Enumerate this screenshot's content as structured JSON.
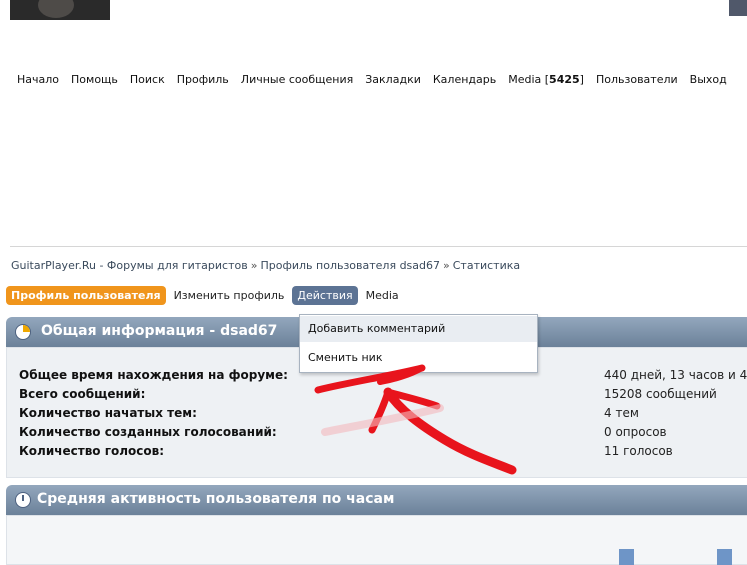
{
  "nav": {
    "items": [
      {
        "label": "Начало"
      },
      {
        "label": "Помощь"
      },
      {
        "label": "Поиск"
      },
      {
        "label": "Профиль"
      },
      {
        "label": "Личные сообщения"
      },
      {
        "label": "Закладки"
      },
      {
        "label": "Календарь"
      },
      {
        "label": "Media [",
        "count": "5425",
        "suffix": "]"
      },
      {
        "label": "Пользователи"
      },
      {
        "label": "Выход"
      }
    ]
  },
  "breadcrumb": {
    "items": [
      "GuitarPlayer.Ru - Форумы для гитаристов",
      "Профиль пользователя dsad67",
      "Статистика"
    ],
    "separator": "»"
  },
  "tabs": {
    "profile": "Профиль пользователя",
    "edit": "Изменить профиль",
    "actions": "Действия",
    "media": "Media"
  },
  "actions_menu": {
    "items": [
      "Добавить комментарий",
      "Сменить ник"
    ]
  },
  "general": {
    "title": "Общая информация - dsad67",
    "rows": [
      {
        "label": "Общее время нахождения на форуме:",
        "value": "440 дней, 13 часов и 4"
      },
      {
        "label": "Всего сообщений:",
        "value": "15208 сообщений"
      },
      {
        "label": "Количество начатых тем:",
        "value": "4 тем"
      },
      {
        "label": "Количество созданных голосований:",
        "value": "0 опросов"
      },
      {
        "label": "Количество голосов:",
        "value": "11 голосов"
      }
    ]
  },
  "activity": {
    "title": "Средняя активность пользователя по часам"
  },
  "colors": {
    "active_tab": "#f0951c",
    "actions_tab": "#5c7394",
    "panel_header": "#7a8fa6",
    "annotation": "#e8141c"
  }
}
